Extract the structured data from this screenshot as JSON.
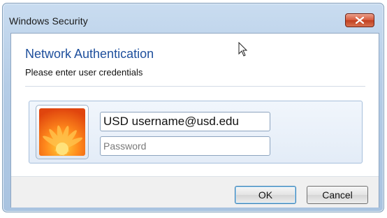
{
  "window": {
    "title": "Windows Security"
  },
  "dialog": {
    "heading": "Network Authentication",
    "subtext": "Please enter user credentials"
  },
  "credentials": {
    "username_value": "USD username@usd.edu",
    "password_placeholder": "Password"
  },
  "buttons": {
    "ok_label": "OK",
    "cancel_label": "Cancel"
  },
  "icons": {
    "close": "close-icon",
    "avatar": "user-avatar-flower",
    "cursor": "mouse-cursor-icon"
  },
  "colors": {
    "heading": "#1e4f9c",
    "close_button": "#c94a2b",
    "frame": "#b4cce6"
  }
}
